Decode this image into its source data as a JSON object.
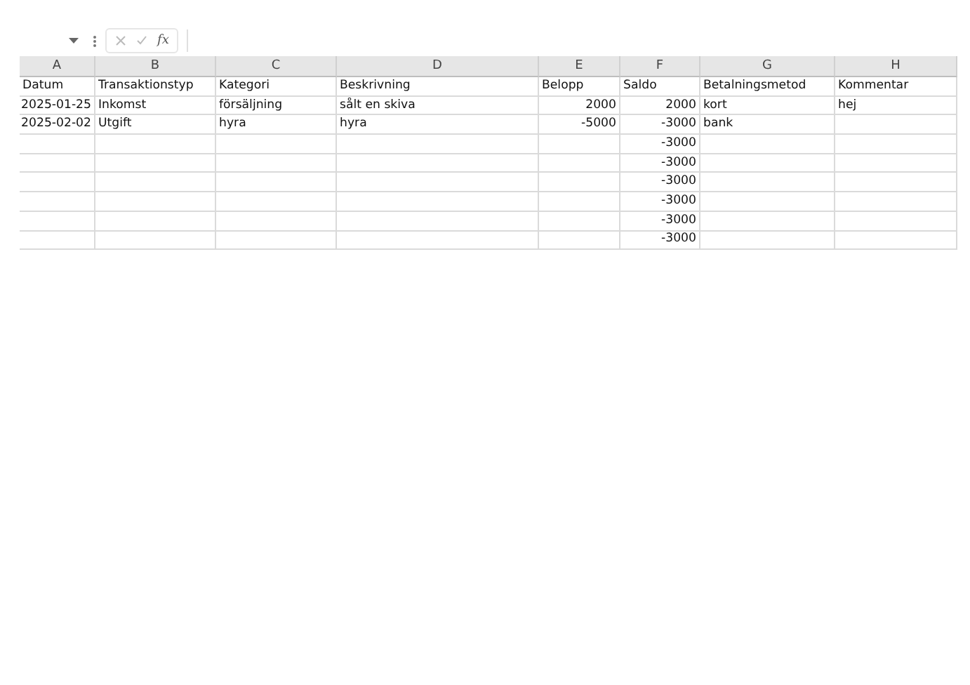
{
  "formula_bar": {
    "function_label": "fx"
  },
  "table": {
    "columns": [
      "A",
      "B",
      "C",
      "D",
      "E",
      "F",
      "G",
      "H"
    ],
    "rows": [
      [
        {
          "text": "Datum",
          "kind": "text"
        },
        {
          "text": "Transaktionstyp",
          "kind": "text"
        },
        {
          "text": "Kategori",
          "kind": "text"
        },
        {
          "text": "Beskrivning",
          "kind": "text"
        },
        {
          "text": "Belopp",
          "kind": "text"
        },
        {
          "text": "Saldo",
          "kind": "text"
        },
        {
          "text": "Betalningsmetod",
          "kind": "text"
        },
        {
          "text": "Kommentar",
          "kind": "text"
        }
      ],
      [
        {
          "text": "2025-01-25",
          "kind": "number"
        },
        {
          "text": "Inkomst",
          "kind": "text"
        },
        {
          "text": "försäljning",
          "kind": "text"
        },
        {
          "text": "sålt en skiva",
          "kind": "text"
        },
        {
          "text": "2000",
          "kind": "number"
        },
        {
          "text": "2000",
          "kind": "number"
        },
        {
          "text": "kort",
          "kind": "text"
        },
        {
          "text": "hej",
          "kind": "text"
        }
      ],
      [
        {
          "text": "2025-02-02",
          "kind": "number"
        },
        {
          "text": "Utgift",
          "kind": "text"
        },
        {
          "text": "hyra",
          "kind": "text"
        },
        {
          "text": "hyra",
          "kind": "text"
        },
        {
          "text": "-5000",
          "kind": "number"
        },
        {
          "text": "-3000",
          "kind": "number"
        },
        {
          "text": "bank",
          "kind": "text"
        },
        null
      ],
      [
        null,
        null,
        null,
        null,
        null,
        {
          "text": "-3000",
          "kind": "number"
        },
        null,
        null
      ],
      [
        null,
        null,
        null,
        null,
        null,
        {
          "text": "-3000",
          "kind": "number"
        },
        null,
        null
      ],
      [
        null,
        null,
        null,
        null,
        null,
        {
          "text": "-3000",
          "kind": "number"
        },
        null,
        null
      ],
      [
        null,
        null,
        null,
        null,
        null,
        {
          "text": "-3000",
          "kind": "number"
        },
        null,
        null
      ],
      [
        null,
        null,
        null,
        null,
        null,
        {
          "text": "-3000",
          "kind": "number"
        },
        null,
        null
      ],
      [
        null,
        null,
        null,
        null,
        null,
        {
          "text": "-3000",
          "kind": "number"
        },
        null,
        null
      ]
    ]
  }
}
